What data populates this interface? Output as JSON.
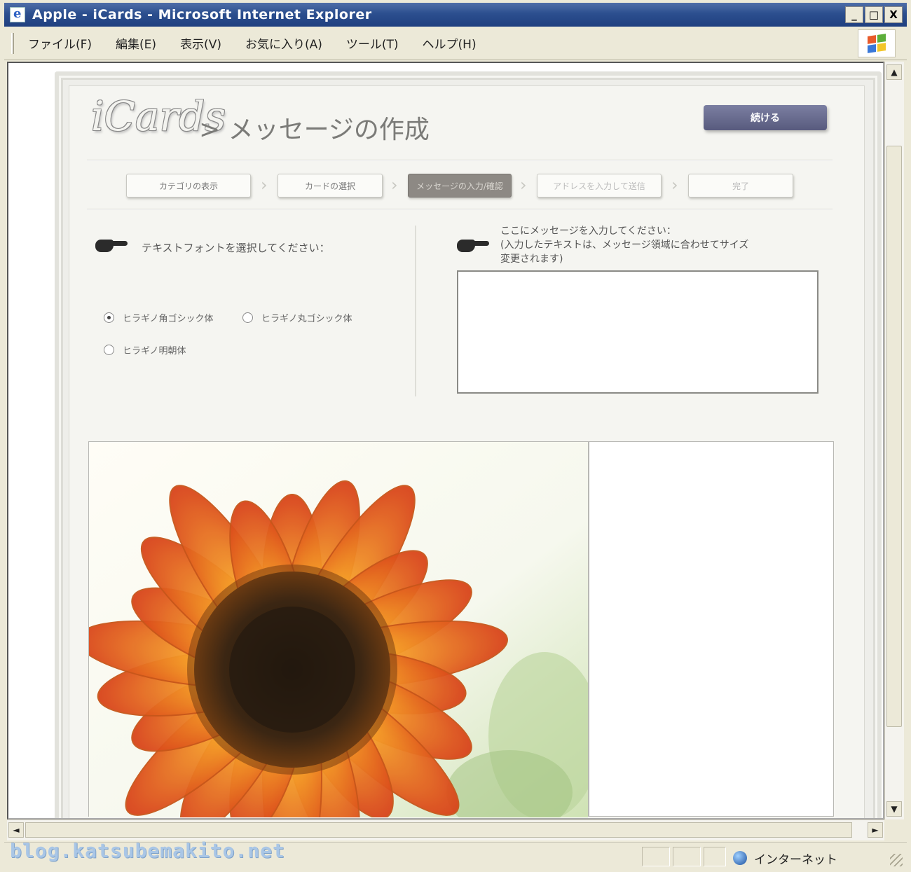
{
  "window": {
    "title": "Apple - iCards - Microsoft Internet Explorer",
    "min_label": "_",
    "max_label": "□",
    "close_label": "X"
  },
  "menu": [
    "ファイル(F)",
    "編集(E)",
    "表示(V)",
    "お気に入り(A)",
    "ツール(T)",
    "ヘルプ(H)"
  ],
  "page": {
    "brand": "iCards",
    "title": "> メッセージの作成",
    "continue_label": "続ける"
  },
  "steps": [
    {
      "label": "カテゴリの表示",
      "state": "done"
    },
    {
      "label": "カードの選択",
      "state": "done"
    },
    {
      "label": "メッセージの入力/確認",
      "state": "active"
    },
    {
      "label": "アドレスを入力して送信",
      "state": "upcoming"
    },
    {
      "label": "完了",
      "state": "upcoming"
    }
  ],
  "font_section": {
    "label": "テキストフォントを選択してください：",
    "options": [
      {
        "label": "ヒラギノ角ゴシック体",
        "selected": true
      },
      {
        "label": "ヒラギノ丸ゴシック体",
        "selected": false
      },
      {
        "label": "ヒラギノ明朝体",
        "selected": false
      }
    ]
  },
  "message_section": {
    "label_line1": "ここにメッセージを入力してください：",
    "label_line2": "(入力したテキストは、メッセージ領域に合わせてサイズ",
    "label_line3": "変更されます)",
    "value": ""
  },
  "status": {
    "zone": "インターネット",
    "watermark": "blog.katsubemakito.net"
  },
  "icons": {
    "pointer": "pointing-hand-icon",
    "zone": "globe-icon"
  },
  "colors": {
    "titlebar": "#2c4f8f",
    "continue_button": "#585a7e",
    "active_step": "#8d8984",
    "petal": "#f08a1a",
    "flower_center": "#3a2412"
  }
}
